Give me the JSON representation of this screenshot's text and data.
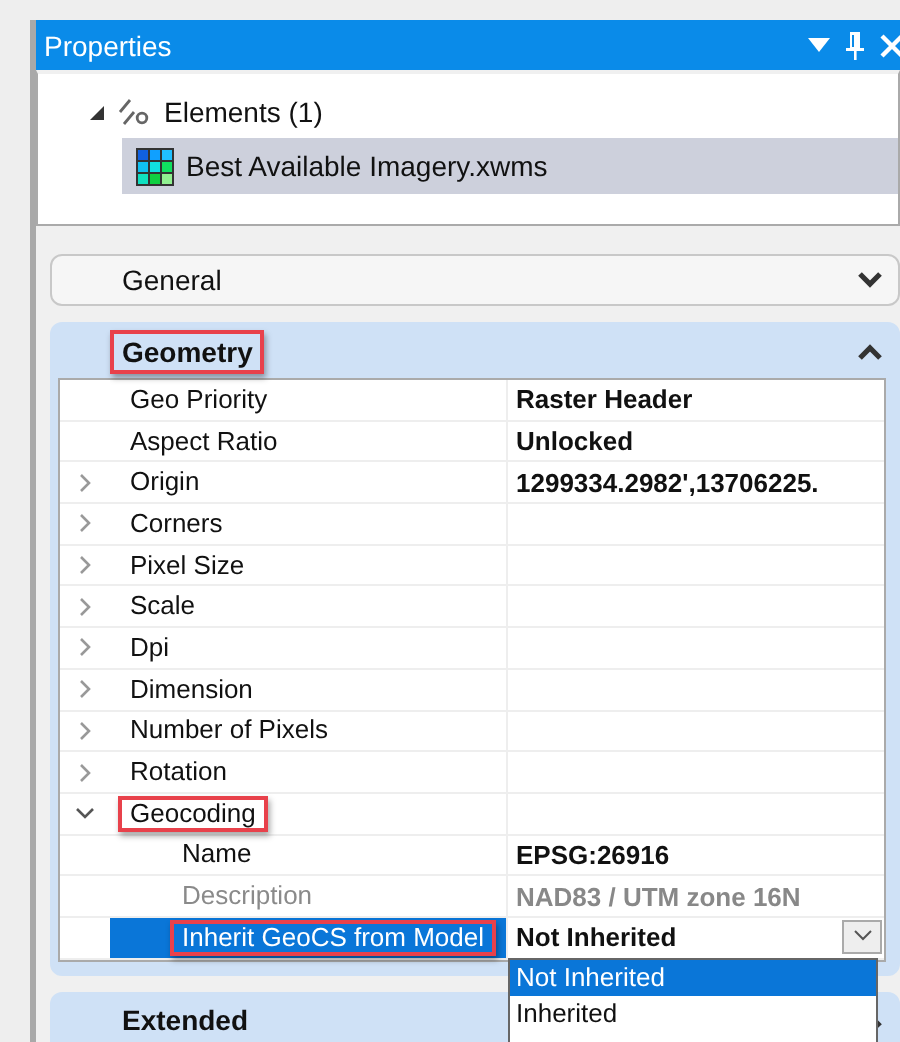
{
  "window": {
    "title": "Properties"
  },
  "tree": [
    {
      "label": "Elements (1)",
      "expanded": true,
      "children": [
        {
          "label": "Best Available Imagery.xwms",
          "selected": true
        }
      ]
    }
  ],
  "sections": [
    {
      "title": "General",
      "expanded": false,
      "highlighted": false
    },
    {
      "title": "Geometry",
      "expanded": true,
      "highlighted": true,
      "properties": [
        {
          "name": "Geo Priority",
          "value": "Raster Header"
        },
        {
          "name": "Aspect Ratio",
          "value": "Unlocked"
        },
        {
          "name": "Origin",
          "value": "1299334.2982',13706225.",
          "expanded": false
        },
        {
          "name": "Corners",
          "expanded": false
        },
        {
          "name": "Pixel Size",
          "expanded": false
        },
        {
          "name": "Scale",
          "expanded": false
        },
        {
          "name": "Dpi",
          "expanded": false
        },
        {
          "name": "Dimension",
          "expanded": false
        },
        {
          "name": "Number of Pixels",
          "expanded": false
        },
        {
          "name": "Rotation",
          "expanded": false
        },
        {
          "name": "Geocoding",
          "expanded": true,
          "highlighted": true,
          "children": [
            {
              "name": "Name",
              "value": "EPSG:26916",
              "disabled": false,
              "selected": false
            },
            {
              "name": "Description",
              "value": "NAD83 / UTM zone 16N",
              "disabled": true,
              "selected": false
            },
            {
              "name": "Inherit GeoCS from Model",
              "value": "Not Inherited",
              "disabled": false,
              "selected": true,
              "highlighted": true,
              "dropdown": {
                "open": true,
                "options": [
                  {
                    "label": "Not Inherited",
                    "selected": true
                  },
                  {
                    "label": "Inherited",
                    "selected": false
                  }
                ]
              }
            }
          ]
        }
      ]
    },
    {
      "title": "Extended",
      "expanded": true,
      "highlighted": false
    }
  ]
}
